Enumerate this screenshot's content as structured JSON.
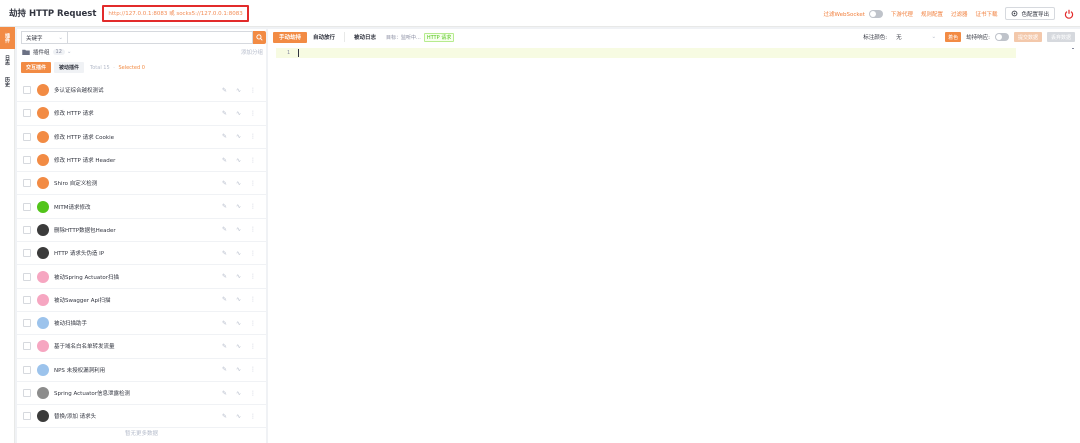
{
  "header": {
    "title": "劫持 HTTP Request",
    "address": "http://127.0.0.1:8083 或 socks5://127.0.0.1:8083",
    "websocket_label": "过滤WebSocket",
    "links": [
      "下游代理",
      "规则配置",
      "过滤器",
      "证书下载"
    ],
    "config_button": "色配置导出",
    "accent": "#f28b44",
    "highlight_box": "#e22b2b"
  },
  "vtabs": [
    "插件",
    "日志",
    "历史"
  ],
  "plugin_panel": {
    "search_select": "关键字",
    "group_label": "插件组",
    "group_count": "12",
    "add_group": "添加分组",
    "tab_active": "交互插件",
    "tab_inactive": "被动插件",
    "total_text": "Total 15",
    "selected_text": "Selected 0",
    "no_more": "暂无更多数据",
    "plugins": [
      {
        "name": "多认证综合越权测试",
        "avatar": "orange",
        "icon": "yak-icon"
      },
      {
        "name": "修改 HTTP 请求",
        "avatar": "orange",
        "icon": "yak-icon"
      },
      {
        "name": "修改 HTTP 请求 Cookie",
        "avatar": "orange",
        "icon": "yak-icon"
      },
      {
        "name": "修改 HTTP 请求 Header",
        "avatar": "orange",
        "icon": "yak-icon"
      },
      {
        "name": "Shiro 自定义检测",
        "avatar": "orange",
        "icon": "yak-icon"
      },
      {
        "name": "MITM请求修改",
        "avatar": "green",
        "icon": "frog-icon"
      },
      {
        "name": "删除HTTP数据包Header",
        "avatar": "dark",
        "icon": "user-avatar-icon"
      },
      {
        "name": "HTTP 请求头伪造 IP",
        "avatar": "dark",
        "icon": "user-avatar-icon"
      },
      {
        "name": "被动Spring Actuator扫描",
        "avatar": "pink",
        "icon": "anime-avatar-icon"
      },
      {
        "name": "被动Swagger Api扫描",
        "avatar": "pink",
        "icon": "anime-avatar-icon"
      },
      {
        "name": "被动扫描助手",
        "avatar": "blue",
        "icon": "user-avatar-icon"
      },
      {
        "name": "基于域名白名单转发流量",
        "avatar": "pink",
        "icon": "anime-avatar-icon"
      },
      {
        "name": "NPS 未授权漏洞利用",
        "avatar": "blue",
        "icon": "user-avatar-icon"
      },
      {
        "name": "Spring Actuator信息泄露检测",
        "avatar": "gray",
        "icon": "user-avatar-icon"
      },
      {
        "name": "替换/添加 请求头",
        "avatar": "dark",
        "icon": "user-avatar-icon"
      }
    ]
  },
  "main": {
    "btn_manual": "手动劫持",
    "btn_auto": "自动放行",
    "btn_log": "被动日志",
    "target_label": "目标：监听中...",
    "target_tag": "HTTP 请求",
    "color_label": "标注颜色:",
    "color_value": "无",
    "highlight_btn": "着色",
    "response_label": "劫持响应:",
    "submit_btn": "提交数据",
    "discard_btn": "丢弃数据",
    "line_number": "1"
  }
}
